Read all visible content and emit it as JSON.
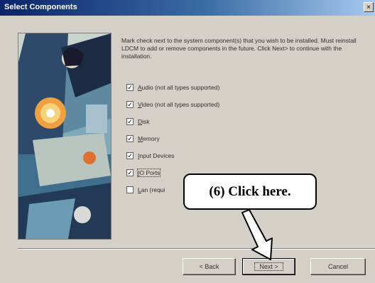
{
  "window": {
    "title": "Select Components",
    "close_glyph": "×"
  },
  "instructions": "Mark check next to the system component(s) that you wish to be installed. Must reinstall LDCM to add or remove components in the future. Click Next> to continue with the installation.",
  "options": [
    {
      "label": "Audio (not all types supported)",
      "underline": "A",
      "rest": "udio (not all types supported)",
      "checked": true
    },
    {
      "label": "Video (not all types supported)",
      "underline": "V",
      "rest": "ideo (not all types supported)",
      "checked": true
    },
    {
      "label": "Disk",
      "underline": "D",
      "rest": "isk",
      "checked": true
    },
    {
      "label": "Memory",
      "underline": "M",
      "rest": "emory",
      "checked": true
    },
    {
      "label": "Input Devices",
      "underline": "I",
      "rest": "nput Devices",
      "checked": true
    },
    {
      "label": "IO Ports",
      "underline": "I",
      "rest": "O Ports",
      "checked": true
    },
    {
      "label": "Lan (requi",
      "underline": "L",
      "rest": "an (requi",
      "checked": false
    }
  ],
  "buttons": {
    "back": "< Back",
    "next": "Next >",
    "cancel": "Cancel"
  },
  "callout": {
    "text": "(6)  Click here."
  },
  "check_glyph": "✓",
  "colors": {
    "title_start": "#0a246a",
    "dialog_bg": "#d4d0c8"
  }
}
